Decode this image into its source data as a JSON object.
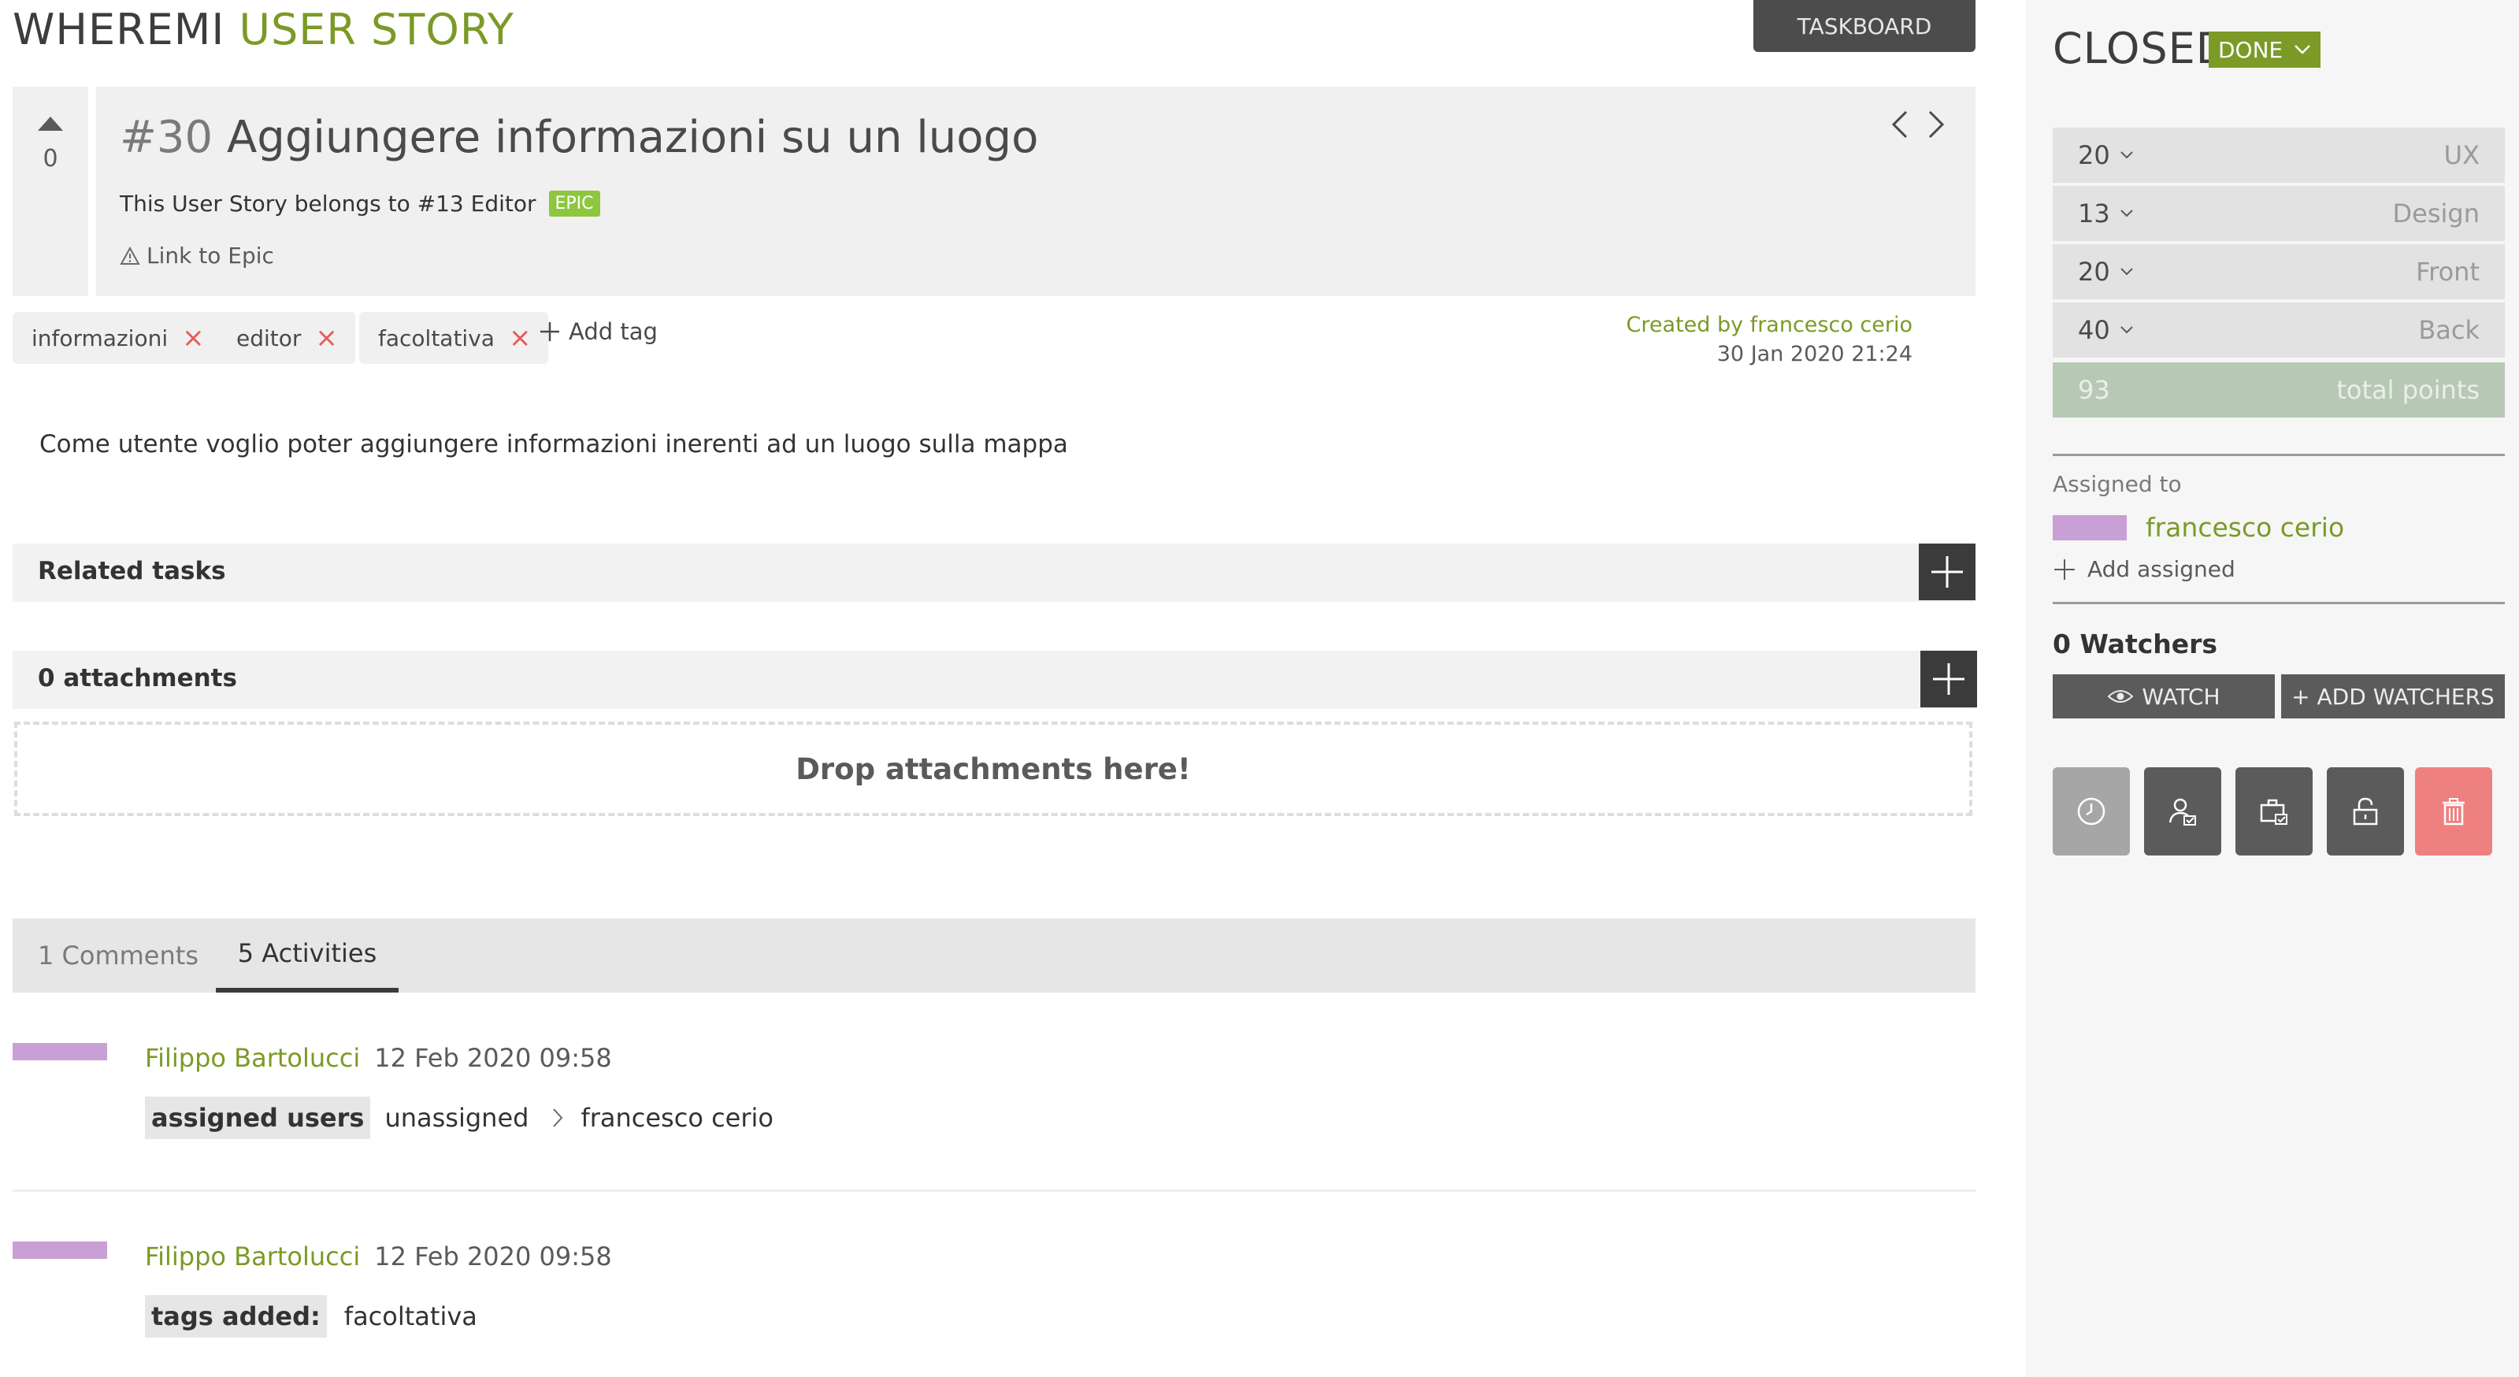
{
  "header": {
    "project": "WHEREMI",
    "section": "USER STORY",
    "taskboard_label": "TASKBOARD"
  },
  "story": {
    "votes": "0",
    "ref": "#30",
    "title": "Aggiungere informazioni su un luogo",
    "belongs_text": "This User Story belongs to #13 Editor",
    "epic_badge": "EPIC",
    "link_epic": "Link to Epic",
    "tags": [
      "informazioni",
      "editor",
      "facoltativa"
    ],
    "add_tag": "Add tag",
    "created_by": "Created by francesco cerio",
    "created_date": "30 Jan 2020 21:24",
    "description": "Come utente voglio poter aggiungere informazioni inerenti ad un luogo sulla mappa"
  },
  "sections": {
    "related_tasks": "Related tasks",
    "attachments": "0 attachments",
    "drop": "Drop attachments here!"
  },
  "tabs": {
    "comments": "1 Comments",
    "activities": "5 Activities"
  },
  "activities": [
    {
      "author": "Filippo Bartolucci",
      "date": "12 Feb 2020 09:58",
      "label": "assigned users",
      "from": "unassigned",
      "to": "francesco cerio"
    },
    {
      "author": "Filippo Bartolucci",
      "date": "12 Feb 2020 09:58",
      "label": "tags added:",
      "value": "facoltativa"
    }
  ],
  "sidebar": {
    "status": "CLOSED",
    "status_value": "DONE",
    "points": [
      {
        "value": "20",
        "role": "UX"
      },
      {
        "value": "13",
        "role": "Design"
      },
      {
        "value": "20",
        "role": "Front"
      },
      {
        "value": "40",
        "role": "Back"
      }
    ],
    "total_value": "93",
    "total_label": "total points",
    "assigned_label": "Assigned to",
    "assigned_name": "francesco cerio",
    "add_assigned": "Add assigned",
    "watchers_title": "0 Watchers",
    "watch_label": "WATCH",
    "add_watchers_label": "+ ADD WATCHERS"
  },
  "colors": {
    "accent": "#7b9a26",
    "epic": "#8dc63f",
    "avatar": "#c9a0d6",
    "delete": "#ef8080",
    "dark": "#3b3b3b"
  }
}
